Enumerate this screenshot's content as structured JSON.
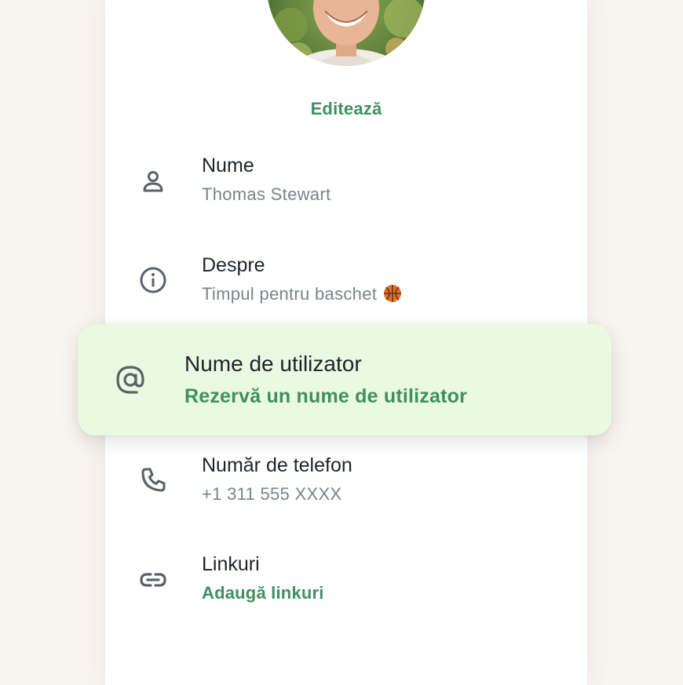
{
  "profile": {
    "edit_label": "Editează"
  },
  "fields": {
    "name": {
      "title": "Nume",
      "value": "Thomas Stewart",
      "icon": "person-icon"
    },
    "about": {
      "title": "Despre",
      "value": "Timpul pentru baschet",
      "emoji": "basketball-icon",
      "icon": "info-icon"
    },
    "username": {
      "title": "Nume de utilizator",
      "value": "Rezervă un nume de utilizator",
      "icon": "at-sign-icon"
    },
    "phone": {
      "title": "Număr de telefon",
      "value": "+1 311 555 XXXX",
      "icon": "phone-icon"
    },
    "links": {
      "title": "Linkuri",
      "value": "Adaugă linkuri",
      "icon": "link-icon"
    }
  },
  "colors": {
    "accent_green": "#3f8f62",
    "highlight_background": "#e9f9e2",
    "page_background": "#f8f4ef"
  }
}
